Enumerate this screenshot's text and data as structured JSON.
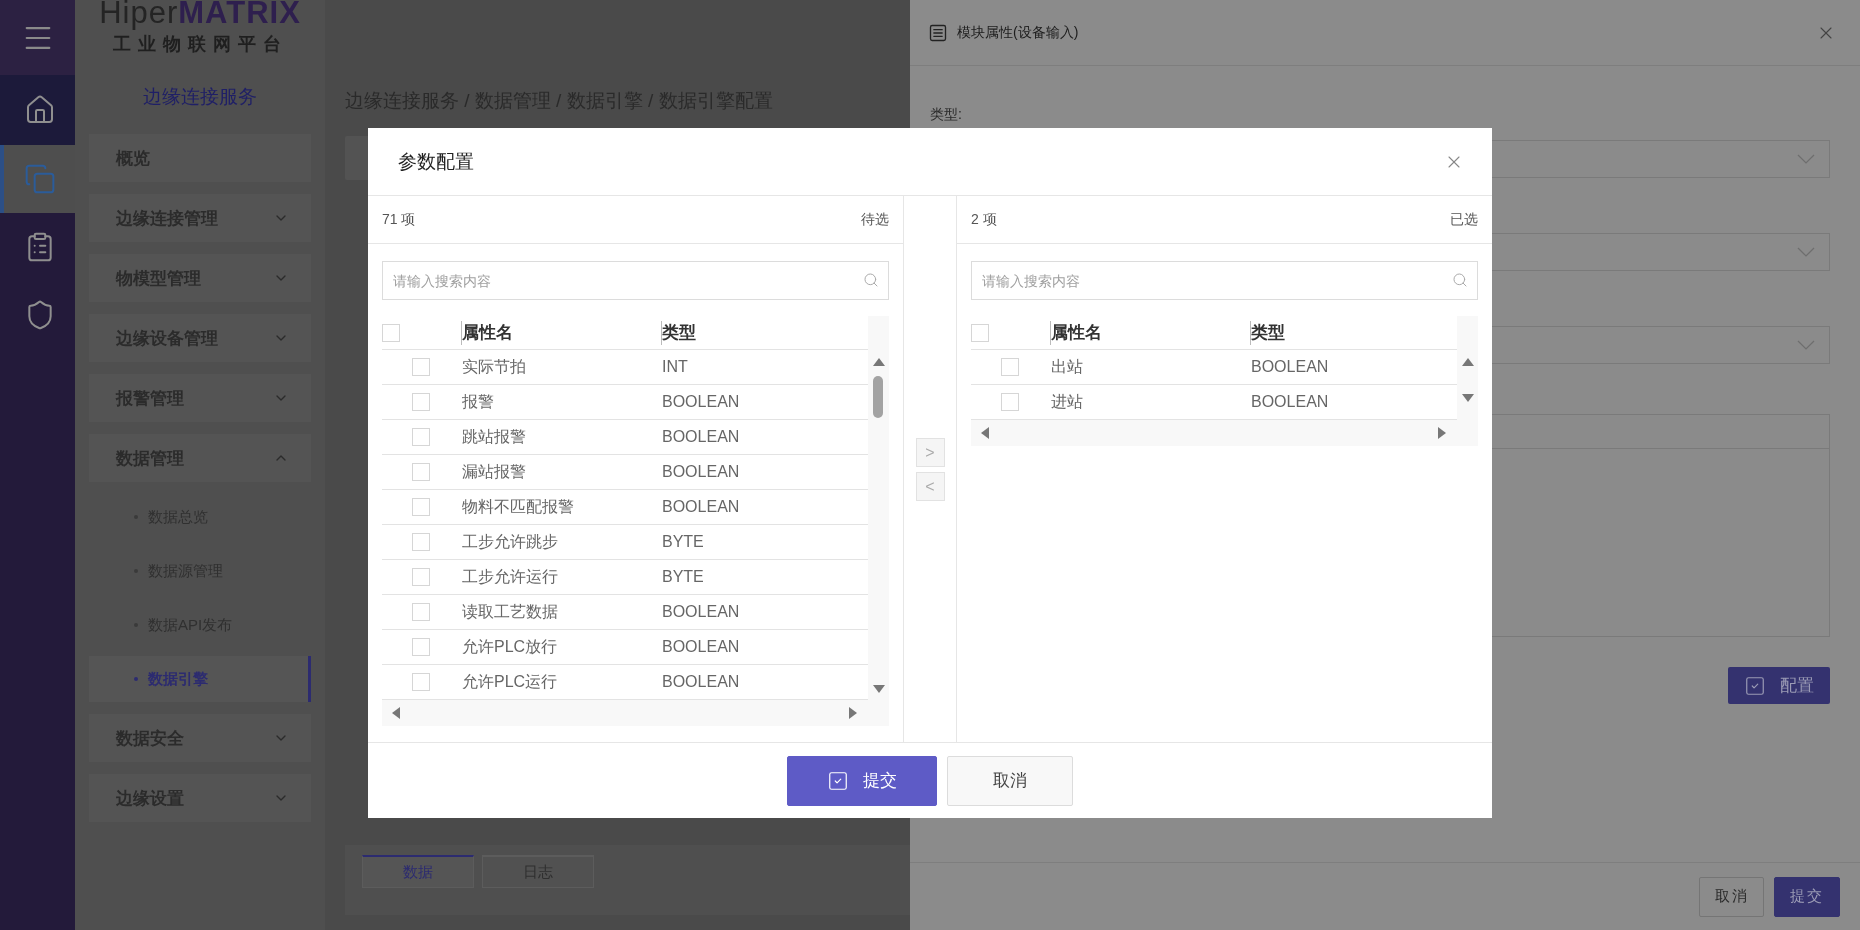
{
  "rail": {
    "items": [
      {
        "kind": "home",
        "selected": false
      },
      {
        "kind": "windows",
        "selected": true
      },
      {
        "kind": "document",
        "selected": false
      },
      {
        "kind": "shield",
        "selected": false
      }
    ]
  },
  "logo": {
    "brand_light": "Hiper",
    "brand_bold": "MATRIX",
    "subtitle": "工业物联网平台"
  },
  "sidebar": {
    "title": "边缘连接服务",
    "items": [
      {
        "label": "概览",
        "kind": "link"
      },
      {
        "label": "边缘连接管理",
        "kind": "group",
        "expanded": false
      },
      {
        "label": "物模型管理",
        "kind": "group",
        "expanded": false
      },
      {
        "label": "边缘设备管理",
        "kind": "group",
        "expanded": false
      },
      {
        "label": "报警管理",
        "kind": "group",
        "expanded": false
      },
      {
        "label": "数据管理",
        "kind": "group",
        "expanded": true,
        "children": [
          {
            "label": "数据总览",
            "selected": false
          },
          {
            "label": "数据源管理",
            "selected": false
          },
          {
            "label": "数据API发布",
            "selected": false
          },
          {
            "label": "数据引擎",
            "selected": true
          }
        ]
      },
      {
        "label": "数据安全",
        "kind": "group",
        "expanded": false
      },
      {
        "label": "边缘设置",
        "kind": "group",
        "expanded": false
      }
    ]
  },
  "breadcrumb": "边缘连接服务 / 数据管理 / 数据引擎 / 数据引擎配置",
  "bottom_tabs": [
    {
      "label": "数据",
      "selected": true
    },
    {
      "label": "日志",
      "selected": false
    }
  ],
  "drawer": {
    "title": "模块属性(设备输入)",
    "fields": [
      {
        "kind": "select",
        "label": "类型:"
      },
      {
        "kind": "select"
      },
      {
        "kind": "select"
      },
      {
        "kind": "input"
      },
      {
        "kind": "textarea"
      }
    ],
    "configure_button": "配置",
    "buttons": [
      {
        "label": "取消",
        "kind": "default"
      },
      {
        "label": "提交",
        "kind": "primary"
      }
    ]
  },
  "modal": {
    "title": "参数配置",
    "source": {
      "count": "71 项",
      "caption": "待选",
      "placeholder": "请输入搜索内容",
      "columns": [
        "属性名",
        "类型"
      ],
      "all_checked": false,
      "rows": [
        {
          "name": "实际节拍",
          "type": "INT",
          "checked": false
        },
        {
          "name": "报警",
          "type": "BOOLEAN",
          "checked": false
        },
        {
          "name": "跳站报警",
          "type": "BOOLEAN",
          "checked": false
        },
        {
          "name": "漏站报警",
          "type": "BOOLEAN",
          "checked": false
        },
        {
          "name": "物料不匹配报警",
          "type": "BOOLEAN",
          "checked": false
        },
        {
          "name": "工步允许跳步",
          "type": "BYTE",
          "checked": false
        },
        {
          "name": "工步允许运行",
          "type": "BYTE",
          "checked": false
        },
        {
          "name": "读取工艺数据",
          "type": "BOOLEAN",
          "checked": false
        },
        {
          "name": "允许PLC放行",
          "type": "BOOLEAN",
          "checked": false
        },
        {
          "name": "允许PLC运行",
          "type": "BOOLEAN",
          "checked": false
        }
      ]
    },
    "move_buttons": [
      ">",
      "<"
    ],
    "target": {
      "count": "2 项",
      "caption": "已选",
      "placeholder": "请输入搜索内容",
      "columns": [
        "属性名",
        "类型"
      ],
      "all_checked": false,
      "rows": [
        {
          "name": "出站",
          "type": "BOOLEAN",
          "checked": false
        },
        {
          "name": "进站",
          "type": "BOOLEAN",
          "checked": false
        }
      ]
    },
    "buttons": [
      {
        "label": "提交",
        "kind": "primary"
      },
      {
        "label": "取消",
        "kind": "default"
      }
    ]
  }
}
